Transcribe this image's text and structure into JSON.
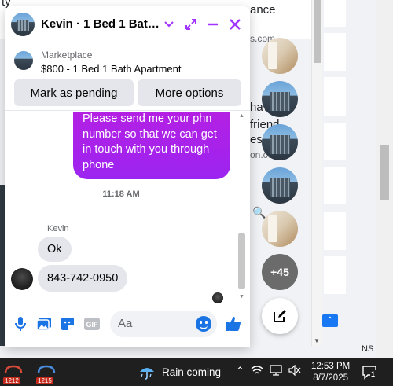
{
  "chat": {
    "contact_title": "Kevin · 1 Bed 1 Bath Ap...",
    "listing": {
      "source": "Marketplace",
      "title": "$800 - 1 Bed 1 Bath Apartment"
    },
    "buttons": {
      "mark_pending": "Mark as pending",
      "more_options": "More options"
    },
    "messages": {
      "outgoing_text": "Please send me your phn number so that we can get in touch with you through phone",
      "timestamp": "11:18 AM",
      "sender_name": "Kevin",
      "incoming_1": "Ok",
      "incoming_2": "843-742-0950"
    },
    "composer": {
      "placeholder": "Aa"
    }
  },
  "chat_heads": {
    "more_count": "+45"
  },
  "background": {
    "frag_ty": "ty",
    "frag_ance": "ance",
    "frag_scom": "s.com",
    "frag_have": "have",
    "frag_friend": "friend",
    "frag_est": "est",
    "frag_oncc": "on.cc",
    "frag_ns": "NS"
  },
  "taskbar": {
    "app1_badge": "1212",
    "app2_badge": "1215",
    "weather_text": "Rain coming",
    "time": "12:53 PM",
    "date": "8/7/2025",
    "notification_count": "1"
  },
  "colors": {
    "messenger_gradient_top": "#b520e3",
    "messenger_gradient_bottom": "#9c24f0",
    "accent_purple": "#a033ff",
    "like_blue": "#1b74e4",
    "taskbar": "#1f1f1f"
  }
}
